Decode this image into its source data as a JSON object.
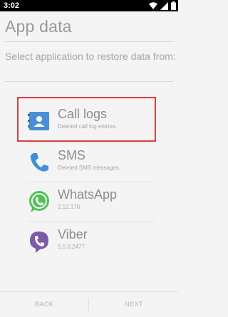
{
  "status_bar": {
    "time": "3:02",
    "icons": [
      "wifi-icon",
      "signal-icon",
      "battery-icon"
    ]
  },
  "page": {
    "title": "App data",
    "subtitle": "Select application to restore data from:"
  },
  "apps": [
    {
      "name": "Call logs",
      "detail": "Deleted call log entries.",
      "icon": "contact-card-icon",
      "color": "#4a8fd6",
      "highlighted": true
    },
    {
      "name": "SMS",
      "detail": "Deleted SMS messages.",
      "icon": "phone-handset-icon",
      "color": "#3d8fe0"
    },
    {
      "name": "WhatsApp",
      "detail": "2.12.176",
      "icon": "whatsapp-icon",
      "color": "#4ec156"
    },
    {
      "name": "Viber",
      "detail": "5.5.0.2477",
      "icon": "viber-icon",
      "color": "#7d5aa8"
    }
  ],
  "footer": {
    "back_label": "BACK",
    "next_label": "NEXT"
  },
  "colors": {
    "highlight_border": "#e03c3c",
    "background": "#f4f4f4"
  }
}
